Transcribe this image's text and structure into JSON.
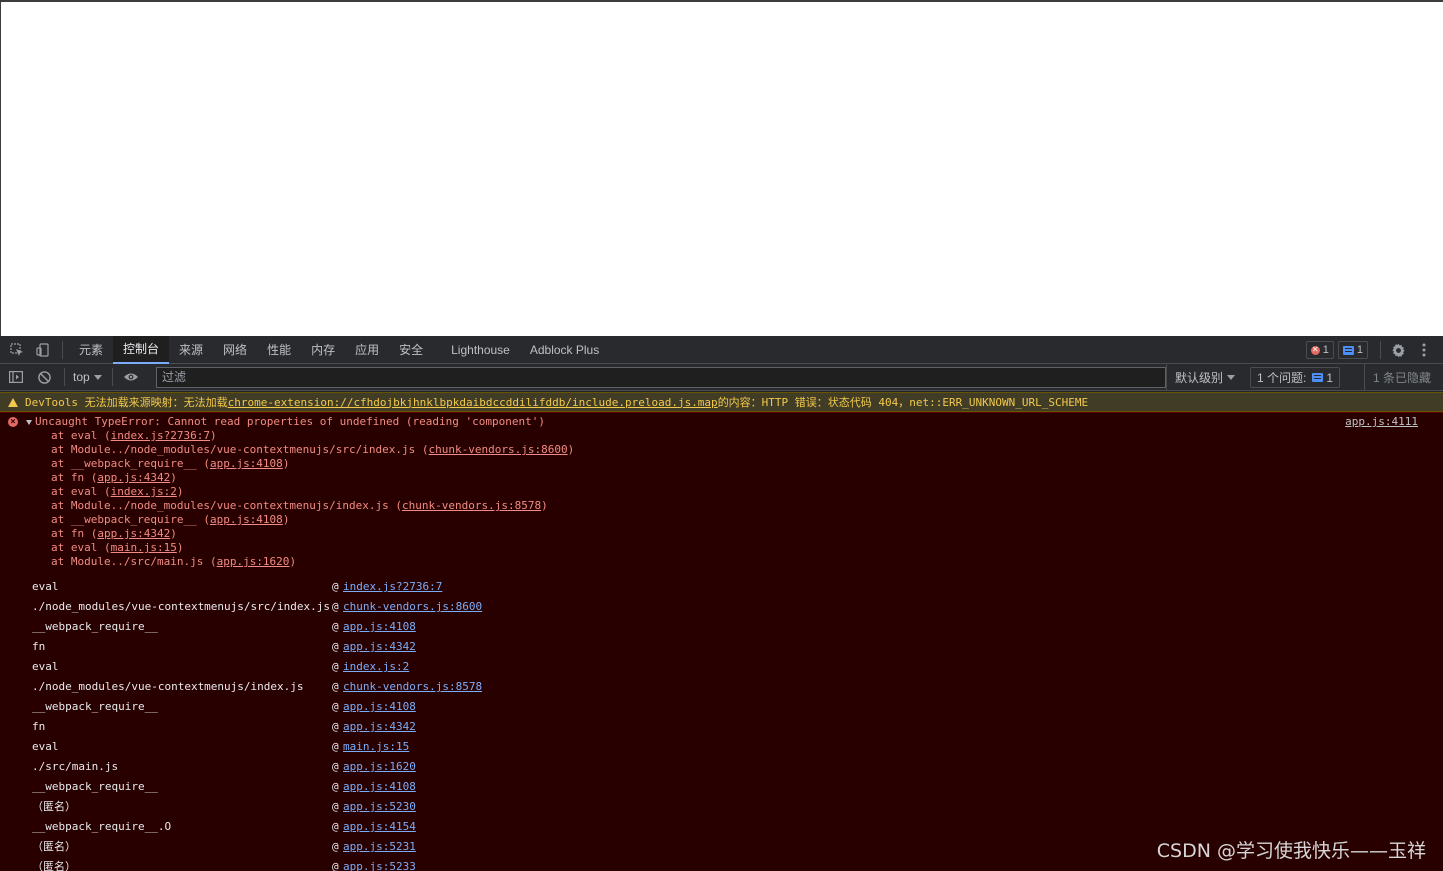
{
  "devtools": {
    "tabs": [
      "元素",
      "控制台",
      "来源",
      "网络",
      "性能",
      "内存",
      "应用",
      "安全",
      "Lighthouse",
      "Adblock Plus"
    ],
    "active_tab": "控制台",
    "error_badge_count": "1",
    "message_badge_count": "1"
  },
  "console_toolbar": {
    "context": "top",
    "filter_placeholder": "过滤",
    "levels": "默认级别",
    "issues_label": "1 个问题:",
    "issues_count": "1",
    "hidden": "1 条已隐藏"
  },
  "warning": {
    "prefix": "DevTools 无法加载来源映射：无法加载 ",
    "link": "chrome-extension://cfhdojbkjhnklbpkdaibdccddilifddb/include.preload.js.map",
    "suffix": " 的内容：HTTP 错误：状态代码 404，net::ERR_UNKNOWN_URL_SCHEME"
  },
  "error": {
    "message": "Uncaught TypeError: Cannot read properties of undefined (reading 'component')",
    "source": "app.js:4111",
    "stack": [
      {
        "text": "at eval (",
        "link": "index.js?2736:7",
        "close": ")"
      },
      {
        "text": "at Module../node_modules/vue-contextmenujs/src/index.js (",
        "link": "chunk-vendors.js:8600",
        "close": ")"
      },
      {
        "text": "at __webpack_require__ (",
        "link": "app.js:4108",
        "close": ")"
      },
      {
        "text": "at fn (",
        "link": "app.js:4342",
        "close": ")"
      },
      {
        "text": "at eval (",
        "link": "index.js:2",
        "close": ")"
      },
      {
        "text": "at Module../node_modules/vue-contextmenujs/index.js (",
        "link": "chunk-vendors.js:8578",
        "close": ")"
      },
      {
        "text": "at __webpack_require__ (",
        "link": "app.js:4108",
        "close": ")"
      },
      {
        "text": "at fn (",
        "link": "app.js:4342",
        "close": ")"
      },
      {
        "text": "at eval (",
        "link": "main.js:15",
        "close": ")"
      },
      {
        "text": "at Module../src/main.js (",
        "link": "app.js:1620",
        "close": ")"
      }
    ],
    "frames": [
      {
        "fn": "eval",
        "link": "index.js?2736:7"
      },
      {
        "fn": "./node_modules/vue-contextmenujs/src/index.js",
        "link": "chunk-vendors.js:8600"
      },
      {
        "fn": "__webpack_require__",
        "link": "app.js:4108"
      },
      {
        "fn": "fn",
        "link": "app.js:4342"
      },
      {
        "fn": "eval",
        "link": "index.js:2"
      },
      {
        "fn": "./node_modules/vue-contextmenujs/index.js",
        "link": "chunk-vendors.js:8578"
      },
      {
        "fn": "__webpack_require__",
        "link": "app.js:4108"
      },
      {
        "fn": "fn",
        "link": "app.js:4342"
      },
      {
        "fn": "eval",
        "link": "main.js:15"
      },
      {
        "fn": "./src/main.js",
        "link": "app.js:1620"
      },
      {
        "fn": "__webpack_require__",
        "link": "app.js:4108"
      },
      {
        "fn": "（匿名）",
        "link": "app.js:5230"
      },
      {
        "fn": "__webpack_require__.O",
        "link": "app.js:4154"
      },
      {
        "fn": "（匿名）",
        "link": "app.js:5231"
      },
      {
        "fn": "（匿名）",
        "link": "app.js:5233"
      }
    ],
    "at_symbol": "@"
  },
  "watermark": "CSDN @学习使我快乐——玉祥",
  "colors": {
    "error_bg": "#290000",
    "error_text": "#f28b82",
    "warning_bg": "#413c26",
    "warning_text": "#f2c94c",
    "link": "#7cacf8",
    "accent": "#7cacf8"
  },
  "icons": [
    "inspect-element-icon",
    "device-toolbar-icon",
    "settings-gear-icon",
    "more-vert-icon",
    "sidebar-toggle-icon",
    "clear-console-icon",
    "eye-icon",
    "error-icon",
    "warning-icon"
  ]
}
